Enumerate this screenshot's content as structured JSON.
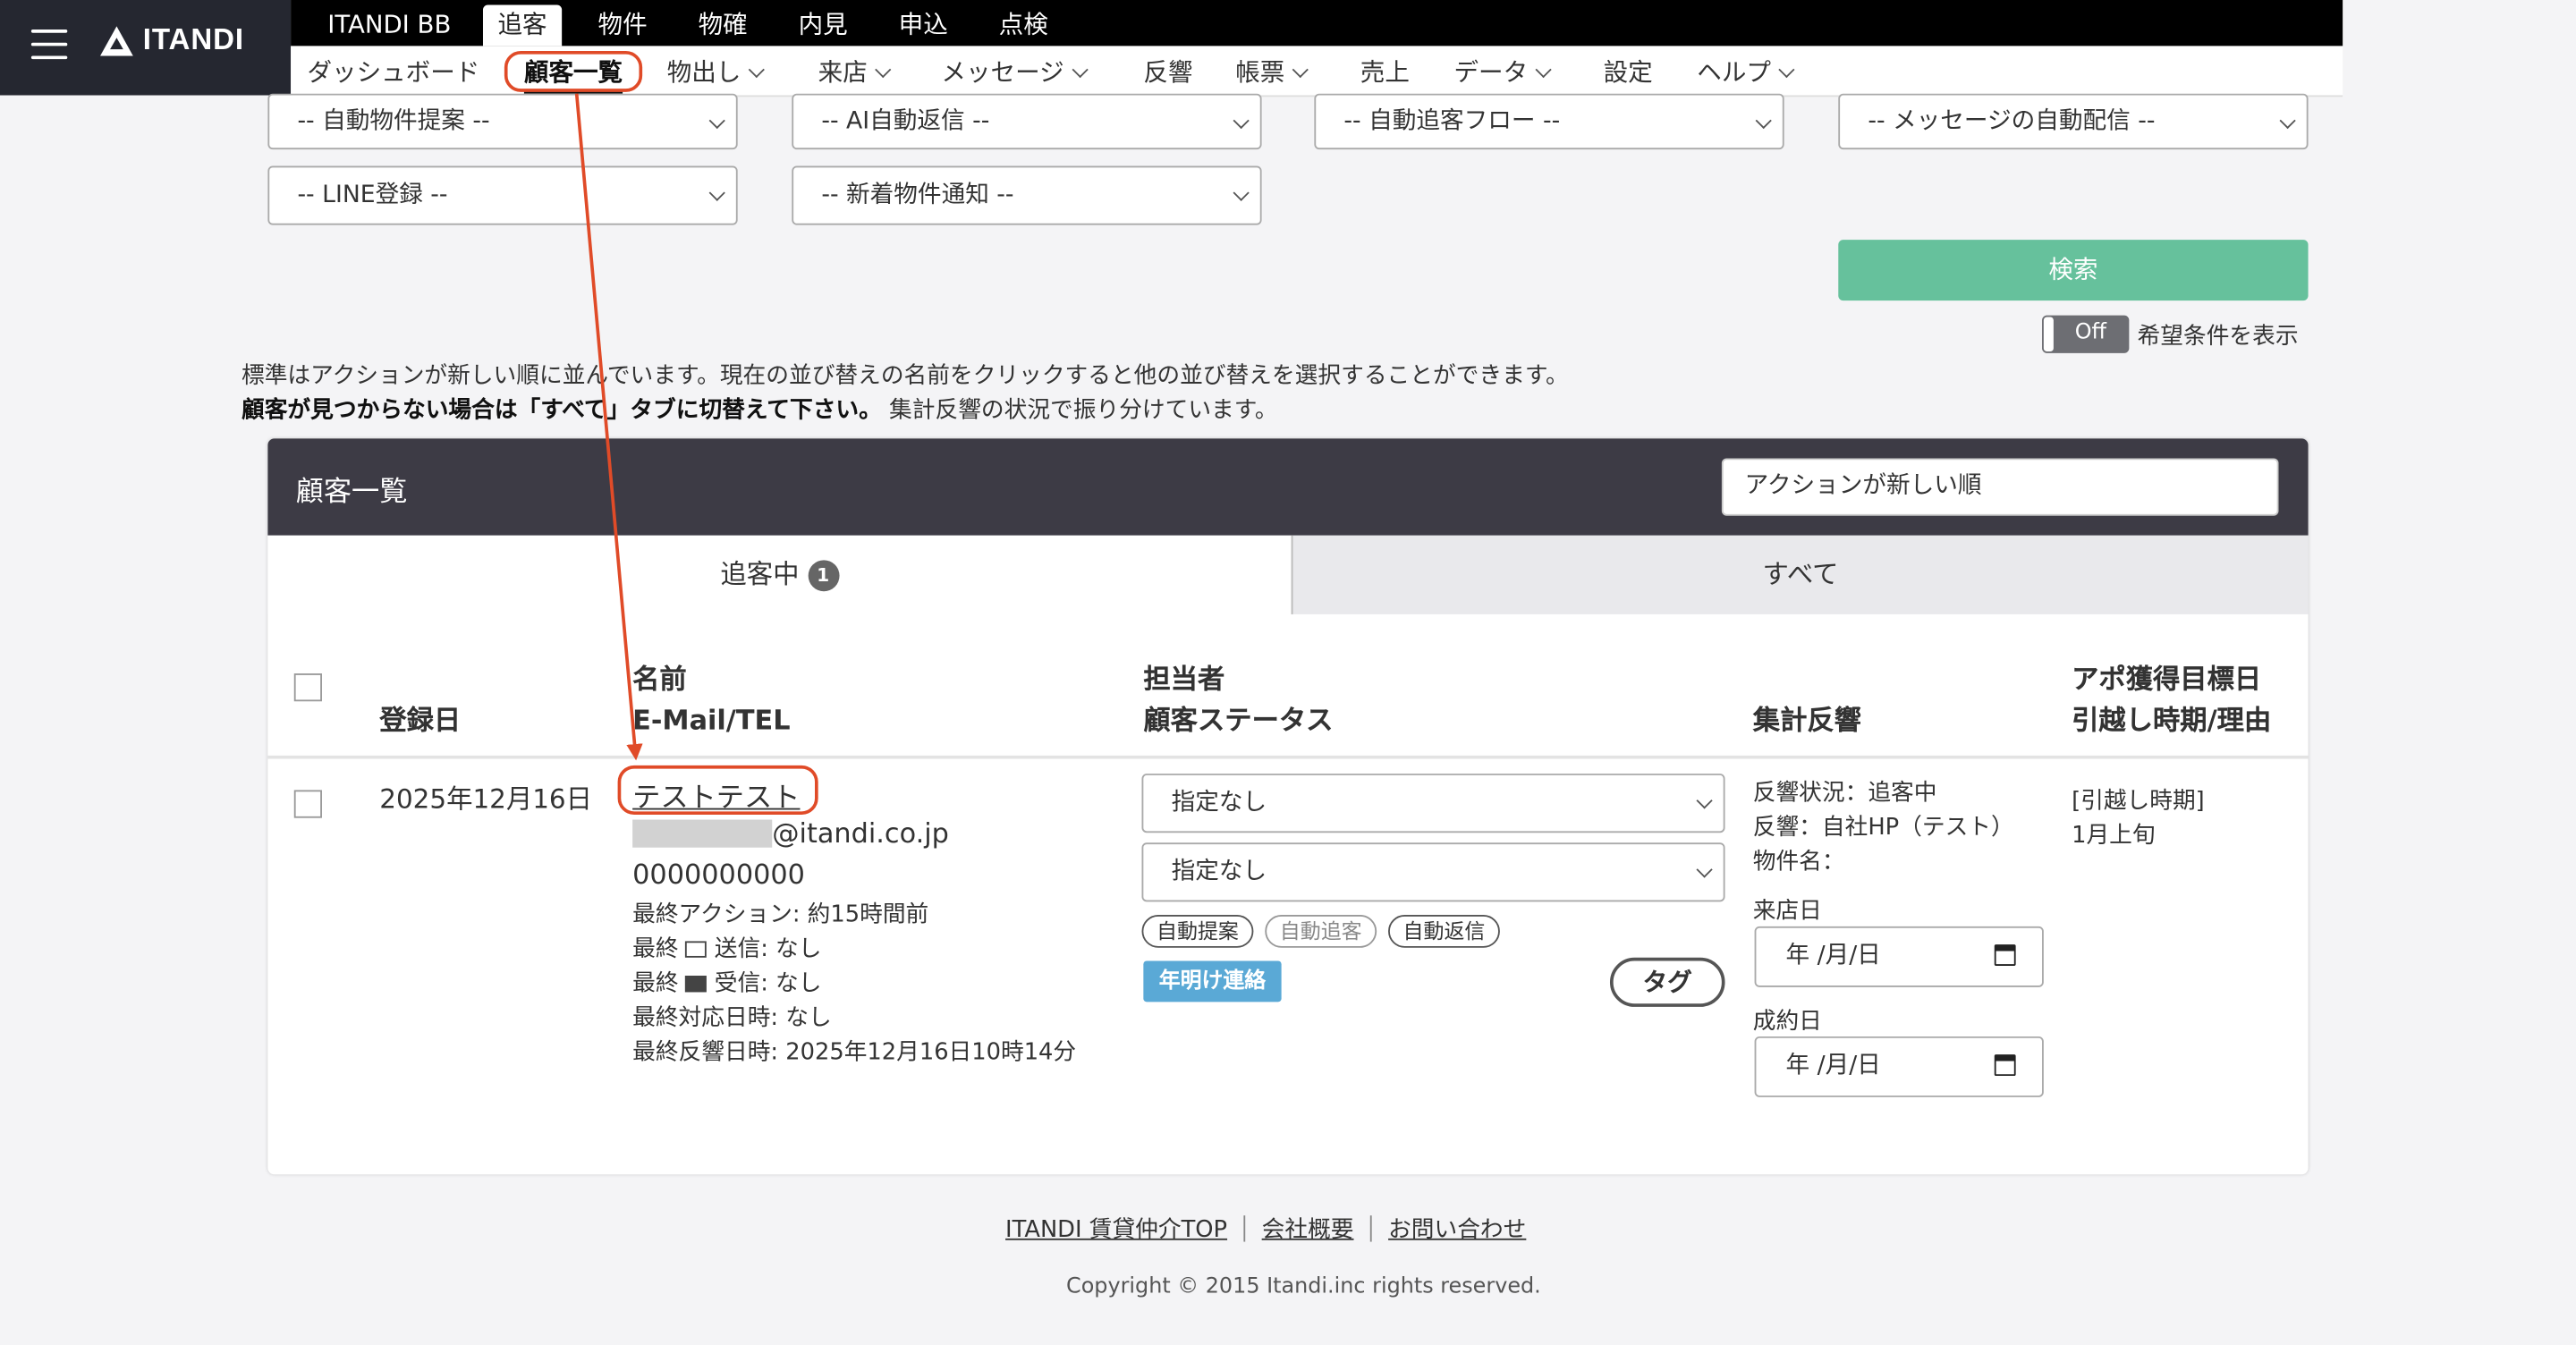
{
  "header": {
    "brand": "ITANDI",
    "top_tabs": [
      "ITANDI BB",
      "追客",
      "物件",
      "物確",
      "内見",
      "申込",
      "点検"
    ],
    "sub_nav": [
      {
        "label": "ダッシュボード"
      },
      {
        "label": "顧客一覧"
      },
      {
        "label": "物出し"
      },
      {
        "label": "来店"
      },
      {
        "label": "メッセージ"
      },
      {
        "label": "反響"
      },
      {
        "label": "帳票"
      },
      {
        "label": "売上"
      },
      {
        "label": "データ"
      },
      {
        "label": "設定"
      },
      {
        "label": "ヘルプ"
      }
    ]
  },
  "filters": {
    "auto_property": "-- 自動物件提案 --",
    "ai_reply": "-- AI自動返信 --",
    "auto_followup": "-- 自動追客フロー --",
    "auto_message": "-- メッセージの自動配信 --",
    "line": "-- LINE登録 --",
    "new_property": "-- 新着物件通知 --",
    "search_label": "検索",
    "toggle_state": "Off",
    "toggle_label": "希望条件を表示"
  },
  "notes": {
    "line1": "標準はアクションが新しい順に並んでいます。現在の並び替えの名前をクリックすると他の並び替えを選択することができます。",
    "line2_bold": "顧客が見つからない場合は「すべて」タブに切替えて下さい。",
    "line2_rest": "集計反響の状況で振り分けています。"
  },
  "panel": {
    "title": "顧客一覧",
    "sort": "アクションが新しい順",
    "tab_active": "追客中",
    "tab_active_count": "1",
    "tab_all": "すべて",
    "headers": {
      "date": "登録日",
      "name": "名前",
      "contact": "E-Mail/TEL",
      "staff": "担当者",
      "status": "顧客ステータス",
      "response": "集計反響",
      "apo": "アポ獲得目標日",
      "move": "引越し時期/理由"
    },
    "row": {
      "date": "2025年12月16日",
      "name": "テストテスト",
      "email_domain": "@itandi.co.jp",
      "tel": "0000000000",
      "last_action": "最終アクション: 約15時間前",
      "last_sent_pre": "最終",
      "last_sent_post": "送信: なし",
      "last_recv_pre": "最終",
      "last_recv_post": "受信: なし",
      "last_handle": "最終対応日時: なし",
      "last_response": "最終反響日時: 2025年12月16日10時14分",
      "staff_select": "指定なし",
      "status_select": "指定なし",
      "pills": [
        "自動提案",
        "自動追客",
        "自動返信"
      ],
      "tag_label": "年明け連絡",
      "tag_button": "タグ",
      "resp_status": "反響状況：追客中",
      "resp_source": "反響：自社HP（テスト）",
      "resp_property": "物件名：",
      "visit_label": "来店日",
      "visit_value": "年 /月/日",
      "contract_label": "成約日",
      "contract_value": "年 /月/日",
      "move_time": "[引越し時期]",
      "move_value": "1月上旬"
    }
  },
  "footer": {
    "links": [
      "ITANDI 賃貸仲介TOP",
      "会社概要",
      "お問い合わせ"
    ],
    "copyright": "Copyright © 2015 Itandi.inc rights reserved."
  },
  "colors": {
    "header_dark": "#252730",
    "search_green": "#66c19c",
    "annotation_red": "#e04b28",
    "tag_blue": "#5aa9d6"
  }
}
